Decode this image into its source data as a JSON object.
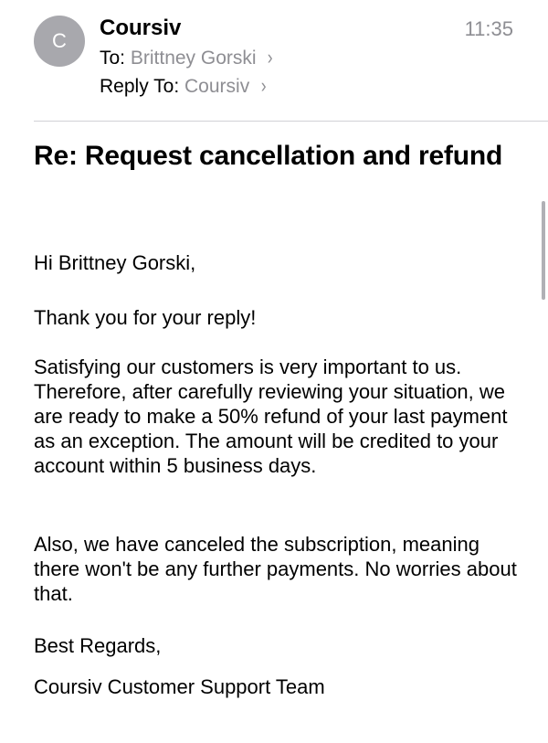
{
  "header": {
    "avatar_letter": "C",
    "sender": "Coursiv",
    "time": "11:35",
    "to_label": "To:",
    "to_value": "Brittney Gorski",
    "reply_label": "Reply To:",
    "reply_value": "Coursiv",
    "chevron": "›"
  },
  "subject": "Re: Request cancellation and refund",
  "body": {
    "greeting": "Hi Brittney Gorski,",
    "thanks": "Thank you for your reply!",
    "main": "Satisfying our customers is very important to us. Therefore, after carefully reviewing your situation, we are ready to make a 50% refund of your last payment as an exception. The amount will be credited to your account within 5 business days.",
    "also": "Also, we have canceled the subscription, meaning there won't be any further payments. No worries about that.",
    "regards": "Best Regards,",
    "signature": "Coursiv Customer Support Team"
  }
}
